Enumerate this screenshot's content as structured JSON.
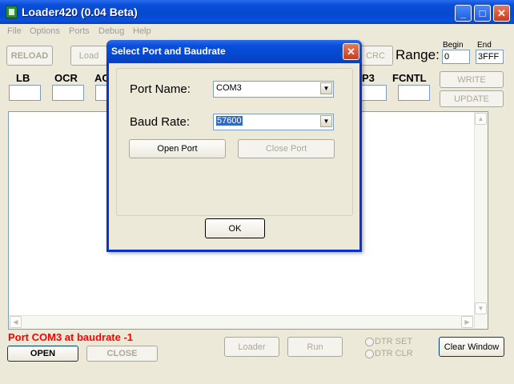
{
  "window": {
    "title": "Loader420 (0.04 Beta)",
    "controls": {
      "minimize": "_",
      "maximize": "□",
      "close": "✕"
    }
  },
  "menu": [
    "File",
    "Options",
    "Ports",
    "Debug",
    "Help"
  ],
  "toolbar": {
    "reload": "RELOAD",
    "load": "Load",
    "crc": "CRC",
    "range_label": "Range:",
    "begin_label": "Begin",
    "begin_value": "0",
    "end_label": "End",
    "end_value": "3FFF"
  },
  "fuses": {
    "lb_label": "LB",
    "ocr_label": "OCR",
    "ac_label": "AC",
    "p3_label": "P3",
    "fcntl_label": "FCNTL"
  },
  "right_buttons": {
    "write": "WRITE",
    "update": "UPDATE"
  },
  "status_text": "Port COM3 at baudrate -1",
  "bottom": {
    "open": "OPEN",
    "close": "CLOSE",
    "loader": "Loader",
    "run": "Run",
    "dtr_set": "DTR SET",
    "dtr_clr": "DTR CLR",
    "clear_window": "Clear Window"
  },
  "dialog": {
    "title": "Select Port and Baudrate",
    "port_name_label": "Port Name:",
    "port_name_value": "COM3",
    "baud_rate_label": "Baud Rate:",
    "baud_rate_value": "57600",
    "open_port": "Open Port",
    "close_port": "Close Port",
    "ok": "OK"
  }
}
